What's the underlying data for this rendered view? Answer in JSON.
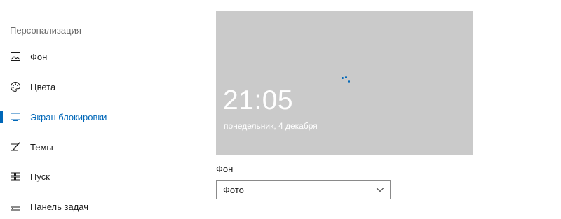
{
  "sidebar": {
    "section_title": "Персонализация",
    "items": [
      {
        "label": "Фон",
        "icon": "picture-icon",
        "active": false
      },
      {
        "label": "Цвета",
        "icon": "palette-icon",
        "active": false
      },
      {
        "label": "Экран блокировки",
        "icon": "lockscreen-icon",
        "active": true
      },
      {
        "label": "Темы",
        "icon": "brush-icon",
        "active": false
      },
      {
        "label": "Пуск",
        "icon": "start-icon",
        "active": false
      },
      {
        "label": "Панель задач",
        "icon": "taskbar-icon",
        "active": false
      }
    ]
  },
  "preview": {
    "time": "21:05",
    "date": "понедельник, 4 декабря",
    "background_color": "#cacaca"
  },
  "background_setting": {
    "label": "Фон",
    "selected": "Фото"
  },
  "colors": {
    "accent": "#0067b8"
  }
}
